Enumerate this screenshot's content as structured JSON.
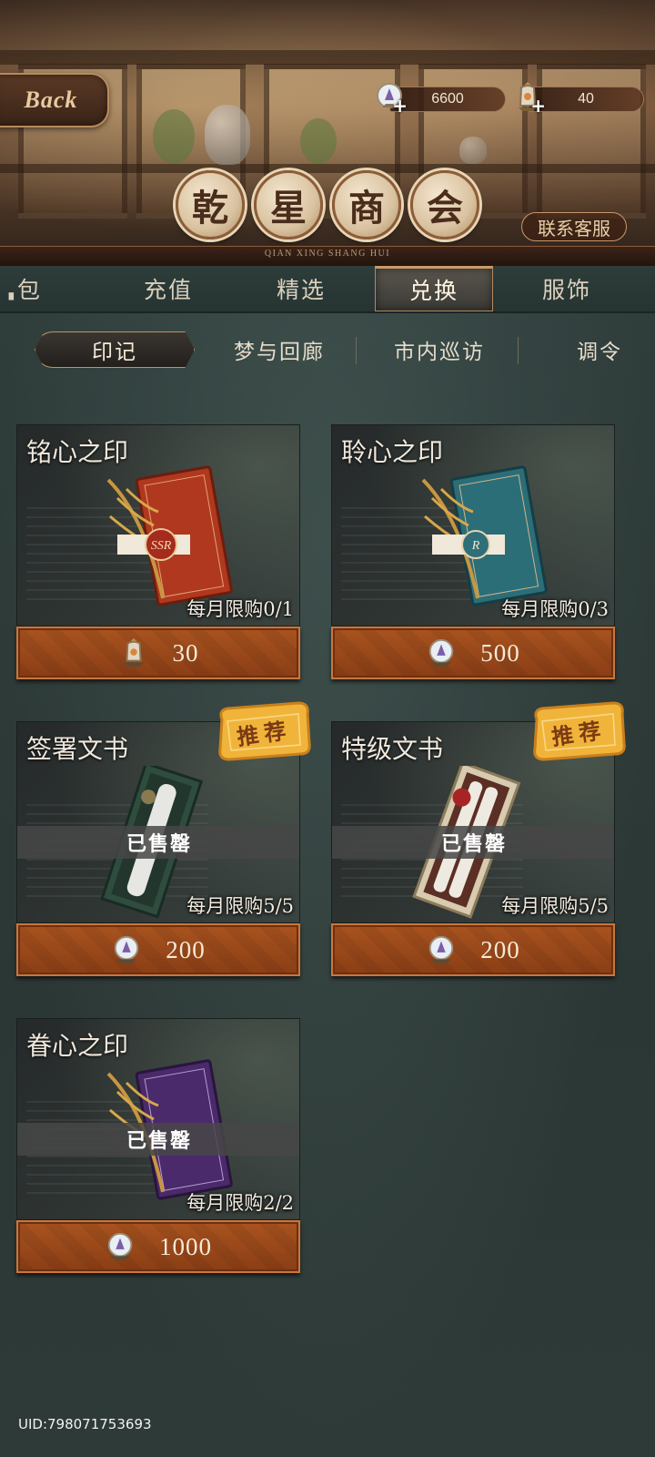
{
  "header": {
    "back_label": "Back",
    "currency": [
      {
        "icon": "crystal-gem-icon",
        "value": "6600"
      },
      {
        "icon": "lantern-gem-icon",
        "value": "40"
      }
    ],
    "title_chars": [
      "乾",
      "星",
      "商",
      "会"
    ],
    "subtitle": "QIAN XING SHANG HUI",
    "support_label": "联系客服"
  },
  "main_tabs": [
    {
      "label": "包",
      "active": false
    },
    {
      "label": "充值",
      "active": false
    },
    {
      "label": "精选",
      "active": false
    },
    {
      "label": "兑换",
      "active": true
    },
    {
      "label": "服饰",
      "active": false
    }
  ],
  "sub_tabs": [
    {
      "label": "印记",
      "active": true
    },
    {
      "label": "梦与回廊",
      "active": false
    },
    {
      "label": "市内巡访",
      "active": false
    },
    {
      "label": "调令",
      "active": false
    }
  ],
  "items": [
    {
      "title": "铭心之印",
      "limit": "每月限购0/1",
      "price": "30",
      "currency_icon": "lantern-gem-icon",
      "sold_out": false,
      "badge": "",
      "color": "#b0381f",
      "art": "seal-letter"
    },
    {
      "title": "聆心之印",
      "limit": "每月限购0/3",
      "price": "500",
      "currency_icon": "crystal-gem-icon",
      "sold_out": false,
      "badge": "",
      "color": "#2b6e78",
      "art": "seal-letter"
    },
    {
      "title": "签署文书",
      "limit": "每月限购5/5",
      "price": "200",
      "currency_icon": "crystal-gem-icon",
      "sold_out": true,
      "sold_out_label": "已售罄",
      "badge": "推荐",
      "color": "#2f4d3f",
      "art": "scroll-box"
    },
    {
      "title": "特级文书",
      "limit": "每月限购5/5",
      "price": "200",
      "currency_icon": "crystal-gem-icon",
      "sold_out": true,
      "sold_out_label": "已售罄",
      "badge": "推荐",
      "color": "#d8cbb0",
      "art": "scroll-box"
    },
    {
      "title": "眷心之印",
      "limit": "每月限购2/2",
      "price": "1000",
      "currency_icon": "crystal-gem-icon",
      "sold_out": true,
      "sold_out_label": "已售罄",
      "badge": "",
      "color": "#4a2a6a",
      "art": "seal-letter"
    }
  ],
  "footer": {
    "uid": "UID:798071753693"
  }
}
